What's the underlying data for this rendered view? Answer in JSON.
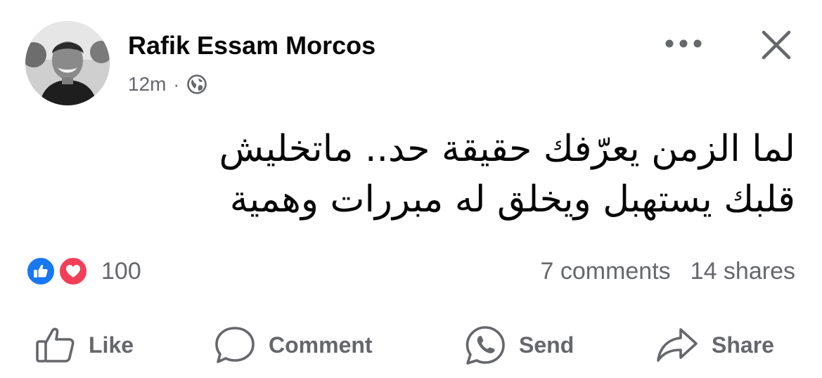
{
  "author": {
    "name": "Rafik Essam Morcos",
    "avatar_icon": "profile-photo"
  },
  "meta": {
    "time": "12m",
    "separator": "·",
    "privacy_icon": "globe-icon"
  },
  "header_actions": {
    "more_icon": "ellipsis-icon",
    "close_icon": "close-icon"
  },
  "post": {
    "lines": [
      "لما الزمن يعرّفك حقيقة حد.. ماتخليش",
      "قلبك يستهبل ويخلق له مبررات وهمية"
    ]
  },
  "reactions": {
    "types": [
      "like",
      "love"
    ],
    "count": "100",
    "like_color": "#1877f2",
    "love_color": "#f33e58"
  },
  "stats": {
    "comments": "7 comments",
    "shares": "14 shares"
  },
  "actions": {
    "like_label": "Like",
    "comment_label": "Comment",
    "send_label": "Send",
    "share_label": "Share"
  },
  "colors": {
    "text_primary": "#050505",
    "text_secondary": "#65676b"
  }
}
